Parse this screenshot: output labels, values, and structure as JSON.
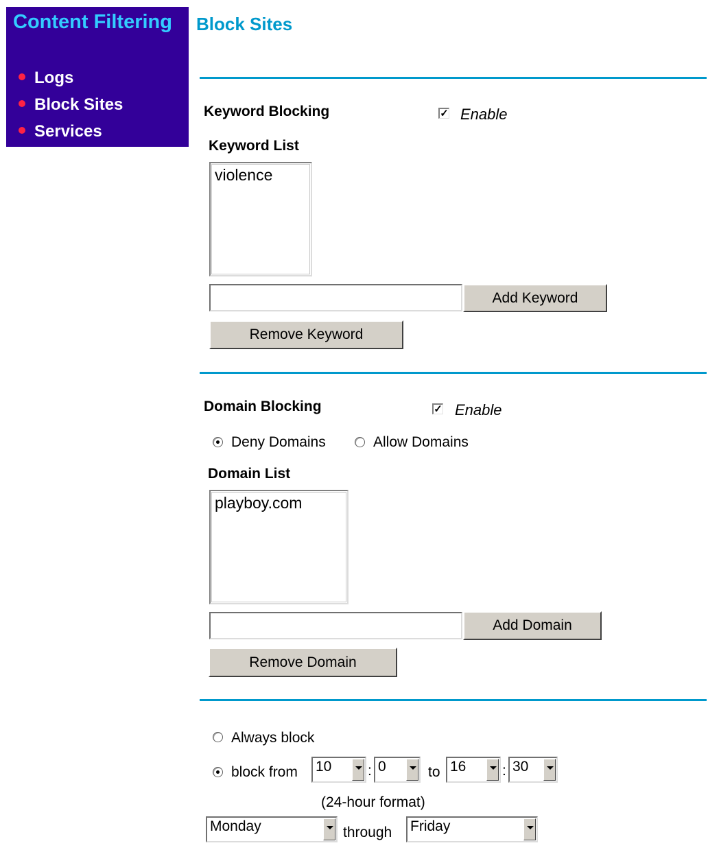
{
  "sidebar": {
    "title": "Content Filtering",
    "items": [
      {
        "label": "Logs"
      },
      {
        "label": "Block Sites"
      },
      {
        "label": "Services"
      }
    ]
  },
  "page": {
    "title": "Block Sites"
  },
  "keyword": {
    "heading": "Keyword Blocking",
    "enabled": true,
    "check_mark": "✓",
    "enable_label": "Enable",
    "list_label": "Keyword List",
    "list_items": [
      "violence"
    ],
    "input_value": "",
    "add_button": "Add Keyword",
    "remove_button": "Remove Keyword"
  },
  "domain": {
    "heading": "Domain Blocking",
    "enabled": true,
    "check_mark": "✓",
    "enable_label": "Enable",
    "mode_selected": "deny",
    "deny_label": "Deny Domains",
    "allow_label": "Allow Domains",
    "list_label": "Domain List",
    "list_items": [
      "playboy.com"
    ],
    "input_value": "",
    "add_button": "Add Domain",
    "remove_button": "Remove Domain"
  },
  "schedule": {
    "selected": "block_from",
    "always_label": "Always block",
    "block_from_label": "block from",
    "start_hour": "10",
    "colon1": ":",
    "start_minute": "0",
    "to_label": "to",
    "end_hour": "16",
    "colon2": ":",
    "end_minute": "30",
    "format_note": "(24-hour format)",
    "start_day": "Monday",
    "through_label": "through",
    "end_day": "Friday"
  },
  "colors": {
    "sidebar_bg": "#330099",
    "sidebar_title": "#33ccff",
    "accent_rule": "#0099cc",
    "bullet": "#ff2244"
  }
}
